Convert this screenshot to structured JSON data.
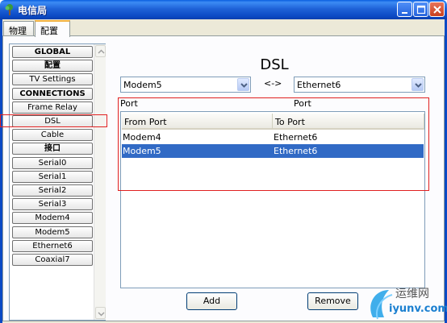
{
  "window": {
    "title": "电信局"
  },
  "tabs": [
    {
      "label": "物理"
    },
    {
      "label": "配置"
    }
  ],
  "sidebar": {
    "items": [
      {
        "label": "GLOBAL",
        "header": true
      },
      {
        "label": "配置",
        "header": true
      },
      {
        "label": "TV Settings",
        "header": false
      },
      {
        "label": "CONNECTIONS",
        "header": true
      },
      {
        "label": "Frame Relay",
        "header": false
      },
      {
        "label": "DSL",
        "header": false,
        "selected": true
      },
      {
        "label": "Cable",
        "header": false
      },
      {
        "label": "接口",
        "header": true
      },
      {
        "label": "Serial0",
        "header": false
      },
      {
        "label": "Serial1",
        "header": false
      },
      {
        "label": "Serial2",
        "header": false
      },
      {
        "label": "Serial3",
        "header": false
      },
      {
        "label": "Modem4",
        "header": false
      },
      {
        "label": "Modem5",
        "header": false
      },
      {
        "label": "Ethernet6",
        "header": false
      },
      {
        "label": "Coaxial7",
        "header": false
      }
    ]
  },
  "main": {
    "title": "DSL",
    "left_select": {
      "value": "Modem5"
    },
    "right_select": {
      "value": "Ethernet6"
    },
    "arrow_text": "<->",
    "left_port_label": "Port",
    "right_port_label": "Port",
    "table": {
      "columns": [
        "From Port",
        "To Port"
      ],
      "rows": [
        {
          "from": "Modem4",
          "to": "Ethernet6",
          "selected": false
        },
        {
          "from": "Modem5",
          "to": "Ethernet6",
          "selected": true
        }
      ]
    },
    "add_label": "Add",
    "remove_label": "Remove"
  },
  "watermark": {
    "cn": "运维网",
    "url": "iyunv.com"
  },
  "colors": {
    "selection": "#316ac5",
    "highlight_box": "#e02020",
    "titlebar": "#0b49c3"
  }
}
